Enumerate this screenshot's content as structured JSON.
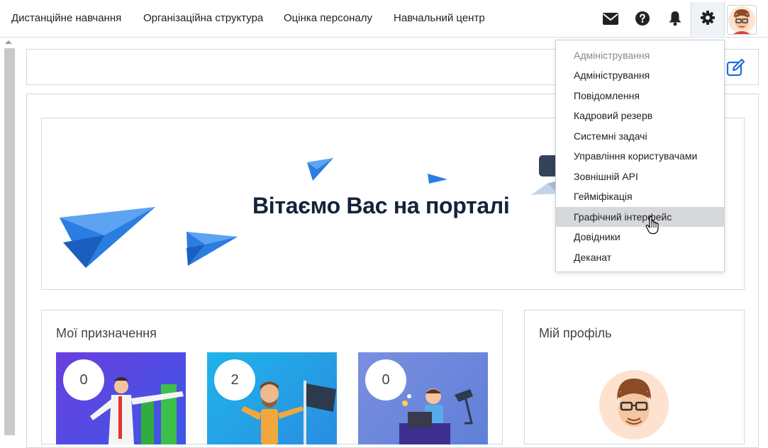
{
  "nav": {
    "items": [
      {
        "label": "Дистанційне навчання"
      },
      {
        "label": "Організаційна структура"
      },
      {
        "label": "Оцінка персоналу"
      },
      {
        "label": "Навчальний центр"
      }
    ]
  },
  "icons": {
    "mail": "envelope-icon",
    "help": "question-circle-icon",
    "notifications": "bell-icon",
    "settings": "gear-icon",
    "edit": "edit-icon"
  },
  "banner": {
    "title": "Вітаємо Вас на порталі"
  },
  "assignments": {
    "title": "Мої призначення",
    "tiles": [
      {
        "count": "0"
      },
      {
        "count": "2"
      },
      {
        "count": "0"
      }
    ]
  },
  "profile": {
    "title": "Мій профіль"
  },
  "admin_menu": {
    "header": "Адміністрування",
    "items": [
      {
        "label": "Адміністрування"
      },
      {
        "label": "Повідомлення"
      },
      {
        "label": "Кадровий резерв"
      },
      {
        "label": "Системні задачі"
      },
      {
        "label": "Управління користувачами"
      },
      {
        "label": "Зовнішній API"
      },
      {
        "label": "Гейміфікація"
      },
      {
        "label": "Графічний інтерфейс"
      },
      {
        "label": "Довідники"
      },
      {
        "label": "Деканат"
      }
    ],
    "active_item": "Графічний інтерфейс"
  },
  "colors": {
    "accent": "#1e6fe0",
    "plane_blue": "#2a7de1",
    "banner_title": "#14233a",
    "tile1_bg": "#5a44e0",
    "tile2_bg": "#27a8e6",
    "tile3_bg": "#6e8fe0"
  }
}
